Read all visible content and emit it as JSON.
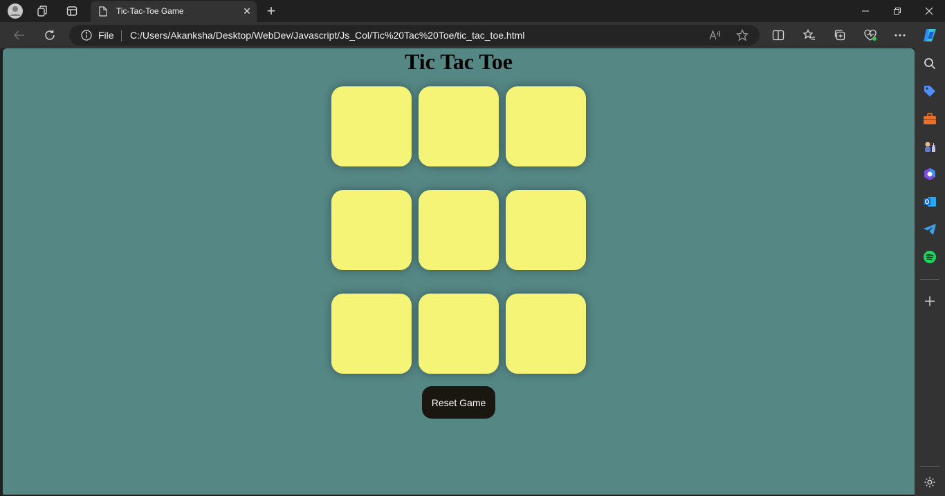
{
  "browser": {
    "tab": {
      "title": "Tic-Tac-Toe Game",
      "close_glyph": "✕",
      "icon": "page-icon"
    },
    "new_tab_glyph": "+",
    "address": {
      "scheme_label": "File",
      "url": "C:/Users/Akanksha/Desktop/WebDev/Javascript/Js_Col/Tic%20Tac%20Toe/tic_tac_toe.html"
    },
    "accent": "#558785"
  },
  "page": {
    "title": "Tic Tac Toe",
    "cells": [
      "",
      "",
      "",
      "",
      "",
      "",
      "",
      "",
      ""
    ],
    "cell_color": "#f5f476",
    "reset_label": "Reset Game"
  },
  "sidebar": {
    "icons": [
      "search-icon",
      "shopping-tag-icon",
      "toolbox-icon",
      "games-icon",
      "copilot-icon",
      "outlook-icon",
      "telegram-icon",
      "spotify-icon",
      "add-icon",
      "settings-icon"
    ]
  }
}
